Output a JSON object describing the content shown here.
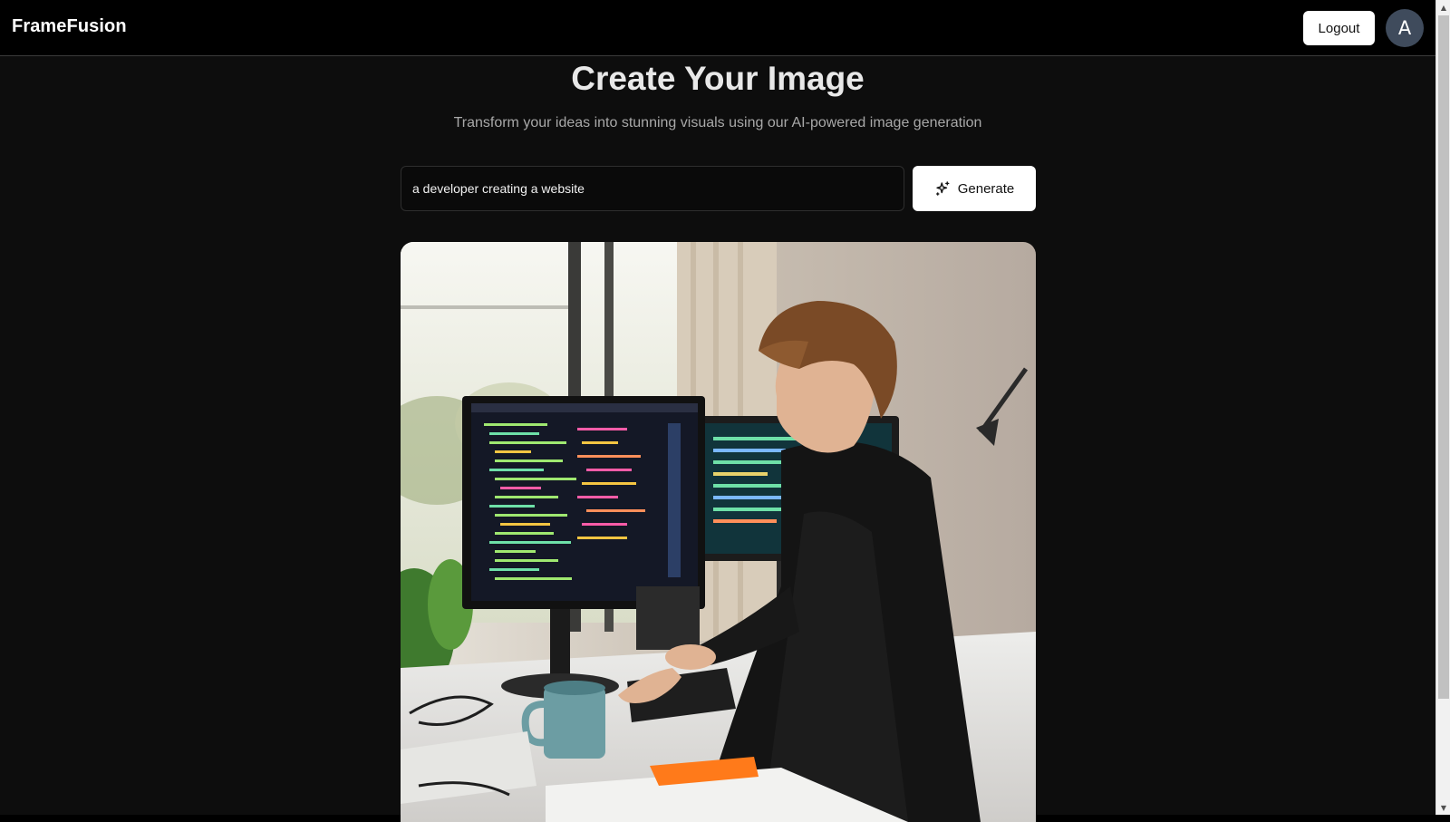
{
  "header": {
    "brand": "FrameFusion",
    "logout_label": "Logout",
    "avatar_initial": "A"
  },
  "hero": {
    "title": "Create Your Image",
    "subtitle": "Transform your ideas into stunning visuals using our AI-powered image generation"
  },
  "prompt": {
    "value": "a developer creating a website",
    "generate_label": "Generate",
    "generate_icon": "sparkles-icon"
  },
  "result": {
    "image_alt": "Generated image of a developer at a desk coding on two monitors"
  },
  "colors": {
    "background": "#000000",
    "button_bg": "#ffffff",
    "avatar_bg": "#3f4b5c"
  }
}
